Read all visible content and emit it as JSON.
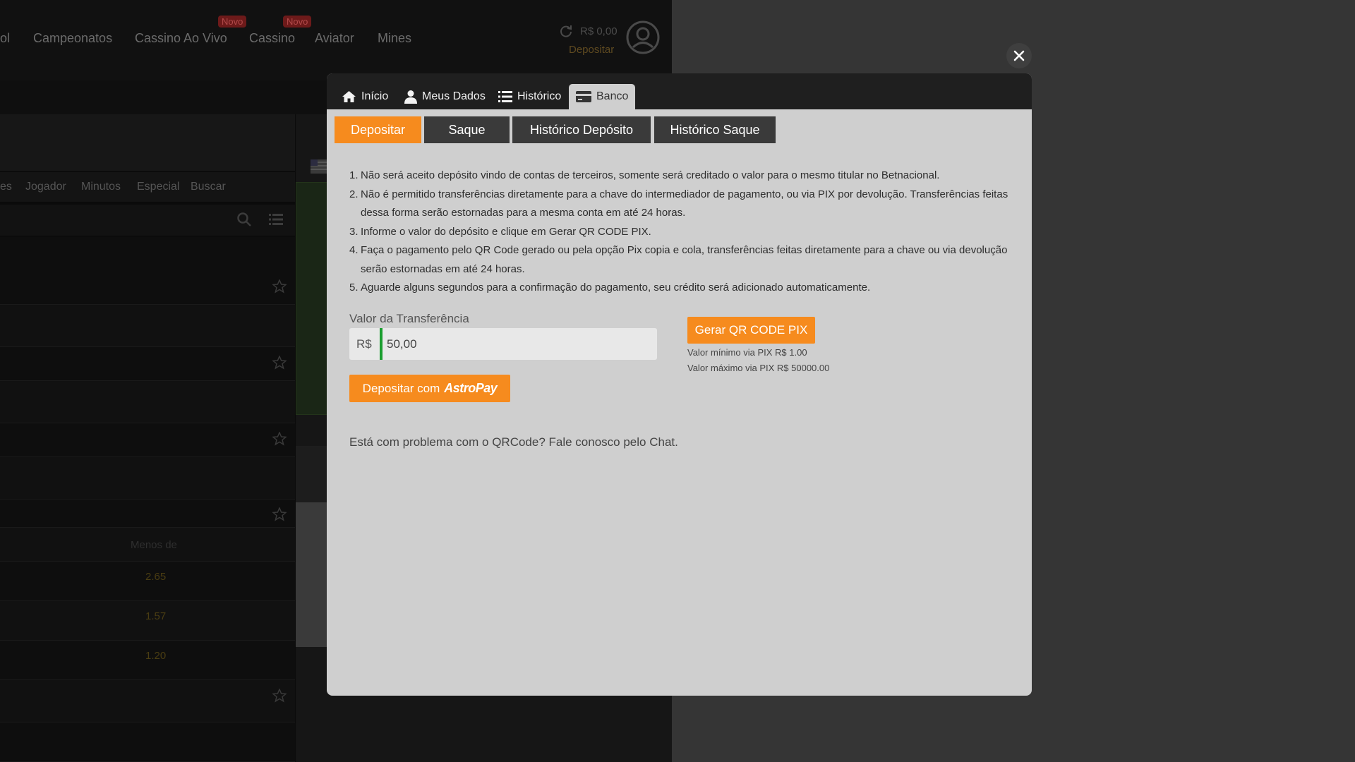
{
  "background": {
    "nav_links": [
      "ol",
      "Campeonatos",
      "Cassino Ao Vivo",
      "Cassino",
      "Aviator",
      "Mines"
    ],
    "nav_badges": [
      "Novo",
      "Novo"
    ],
    "balance": "R$ 0,00",
    "deposit_link": "Depositar",
    "filters": [
      "es",
      "Jogador",
      "Minutos",
      "Especial",
      "Buscar"
    ],
    "odds_header": "Menos de",
    "odds": [
      "2.65",
      "1.57",
      "1.20"
    ]
  },
  "modal": {
    "tabs": [
      {
        "label": "Início",
        "icon": "home-icon"
      },
      {
        "label": "Meus Dados",
        "icon": "user-icon"
      },
      {
        "label": "Histórico",
        "icon": "list-icon"
      },
      {
        "label": "Banco",
        "icon": "card-icon",
        "active": true
      }
    ],
    "subtabs": [
      {
        "label": "Depositar",
        "active": true
      },
      {
        "label": "Saque"
      },
      {
        "label": "Histórico Depósito"
      },
      {
        "label": "Histórico Saque"
      }
    ],
    "rules": [
      "Não será aceito depósito vindo de contas de terceiros, somente será creditado o valor para o mesmo titular no Betnacional.",
      "Não é permitido transferências diretamente para a chave do intermediador de pagamento, ou via PIX por devolução. Transferências feitas dessa forma serão estornadas para a mesma conta em até 24 horas.",
      "Informe o valor do depósito e clique em Gerar QR CODE PIX.",
      "Faça o pagamento pelo QR Code gerado ou pela opção Pix copia e cola, transferências feitas diretamente para a chave ou via devolução serão estornadas em até 24 horas.",
      "Aguarde alguns segundos para a confirmação do pagamento, seu crédito será adicionado automaticamente."
    ],
    "amount_label": "Valor da Transferência",
    "currency_prefix": "R$",
    "amount_value": "50,00",
    "generate_button": "Gerar QR CODE PIX",
    "min_note": "Valor mínimo via PIX R$ 1.00",
    "max_note": "Valor máximo via PIX R$ 50000.00",
    "astropay_button": "Depositar com",
    "astropay_logo": "AstroPay",
    "problem_text": "Está com problema com o QRCode? Fale conosco pelo Chat."
  },
  "colors": {
    "accent": "#f68b1e",
    "input_bar": "#1b9e2f",
    "modal_bg": "#cfcfcf",
    "header_bg": "#1f1f1f"
  }
}
